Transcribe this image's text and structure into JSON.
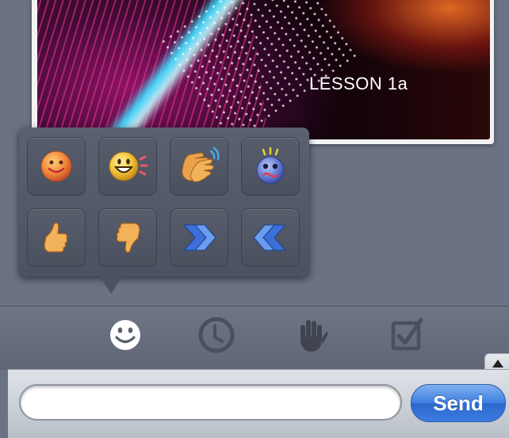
{
  "slide": {
    "title": "LESSON 1a"
  },
  "popover": {
    "emoticons": [
      {
        "name": "smile-icon"
      },
      {
        "name": "laugh-icon"
      },
      {
        "name": "applause-icon"
      },
      {
        "name": "surprised-icon"
      },
      {
        "name": "thumbs-up-icon"
      },
      {
        "name": "thumbs-down-icon"
      },
      {
        "name": "speed-up-icon"
      },
      {
        "name": "slow-down-icon"
      }
    ]
  },
  "toolbar": {
    "items": [
      {
        "name": "emoticon-tab",
        "icon": "smiley-icon",
        "active": true
      },
      {
        "name": "clock-tab",
        "icon": "clock-icon",
        "active": false
      },
      {
        "name": "raise-hand-tab",
        "icon": "hand-icon",
        "active": false
      },
      {
        "name": "poll-tab",
        "icon": "checkbox-icon",
        "active": false
      }
    ]
  },
  "input": {
    "value": "",
    "placeholder": ""
  },
  "send": {
    "label": "Send"
  },
  "colors": {
    "background": "#6b7283",
    "send_button": "#3d7ee0",
    "active_icon": "#ffffff",
    "inactive_icon": "#4a4f5b"
  }
}
